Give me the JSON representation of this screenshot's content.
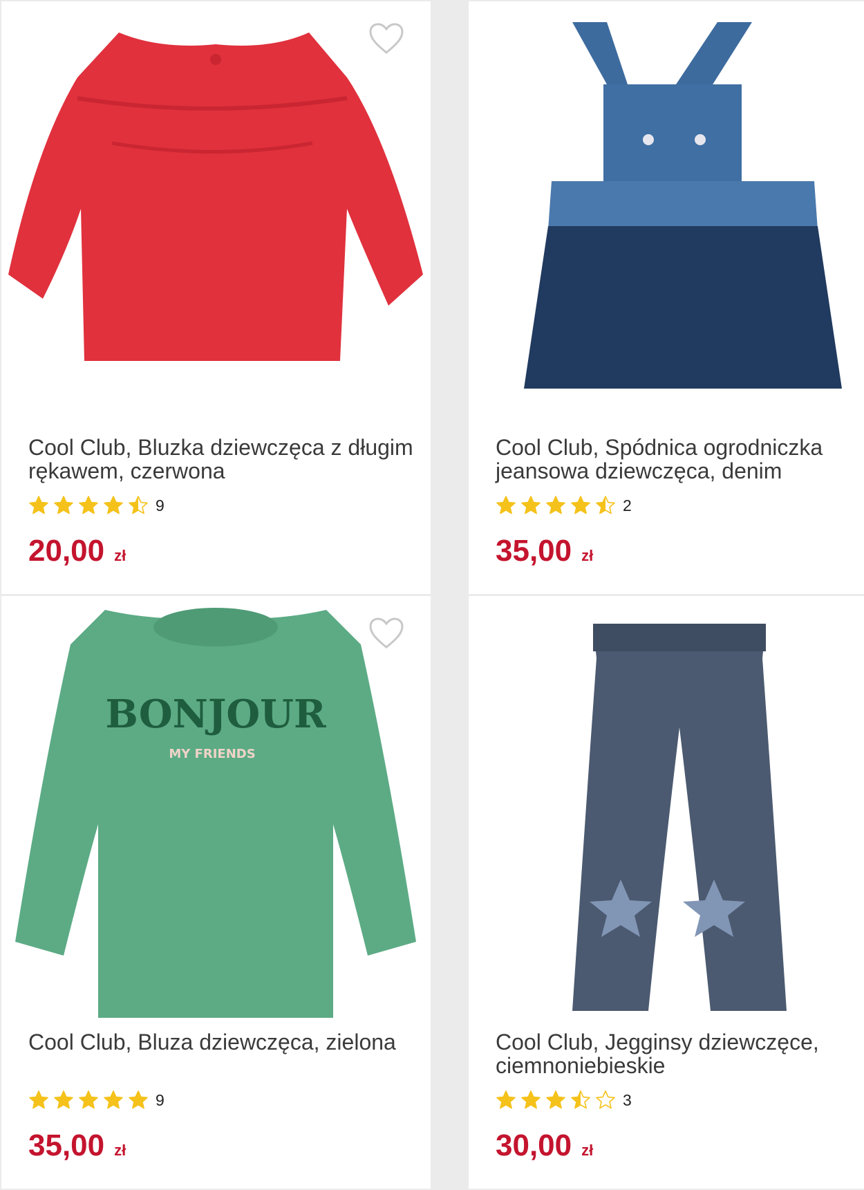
{
  "colors": {
    "price": "#c4142e",
    "star": "#f5c21b",
    "page_bg": "#ebebeb"
  },
  "products": [
    {
      "title": "Cool Club, Bluzka dziewczęca z długim rękawem, czerwona",
      "rating": 4.5,
      "reviews": "9",
      "price": "20,00",
      "currency": "zł",
      "image": "red-blouse-image"
    },
    {
      "title": "Cool Club, Spódnica ogrodniczka jeansowa dziewczęca, denim",
      "rating": 4.5,
      "reviews": "2",
      "price": "35,00",
      "currency": "zł",
      "image": "denim-pinafore-image"
    },
    {
      "title": "Cool Club, Bluza dziewczęca, zielona",
      "rating": 5,
      "reviews": "9",
      "price": "35,00",
      "currency": "zł",
      "image": "green-sweatshirt-image",
      "print": {
        "main": "BONJOUR",
        "sub": "MY FRIENDS"
      }
    },
    {
      "title": "Cool Club, Jegginsy dziewczęce, ciemnoniebieskie",
      "rating": 3.5,
      "reviews": "3",
      "price": "30,00",
      "currency": "zł",
      "image": "jeggings-image"
    }
  ]
}
